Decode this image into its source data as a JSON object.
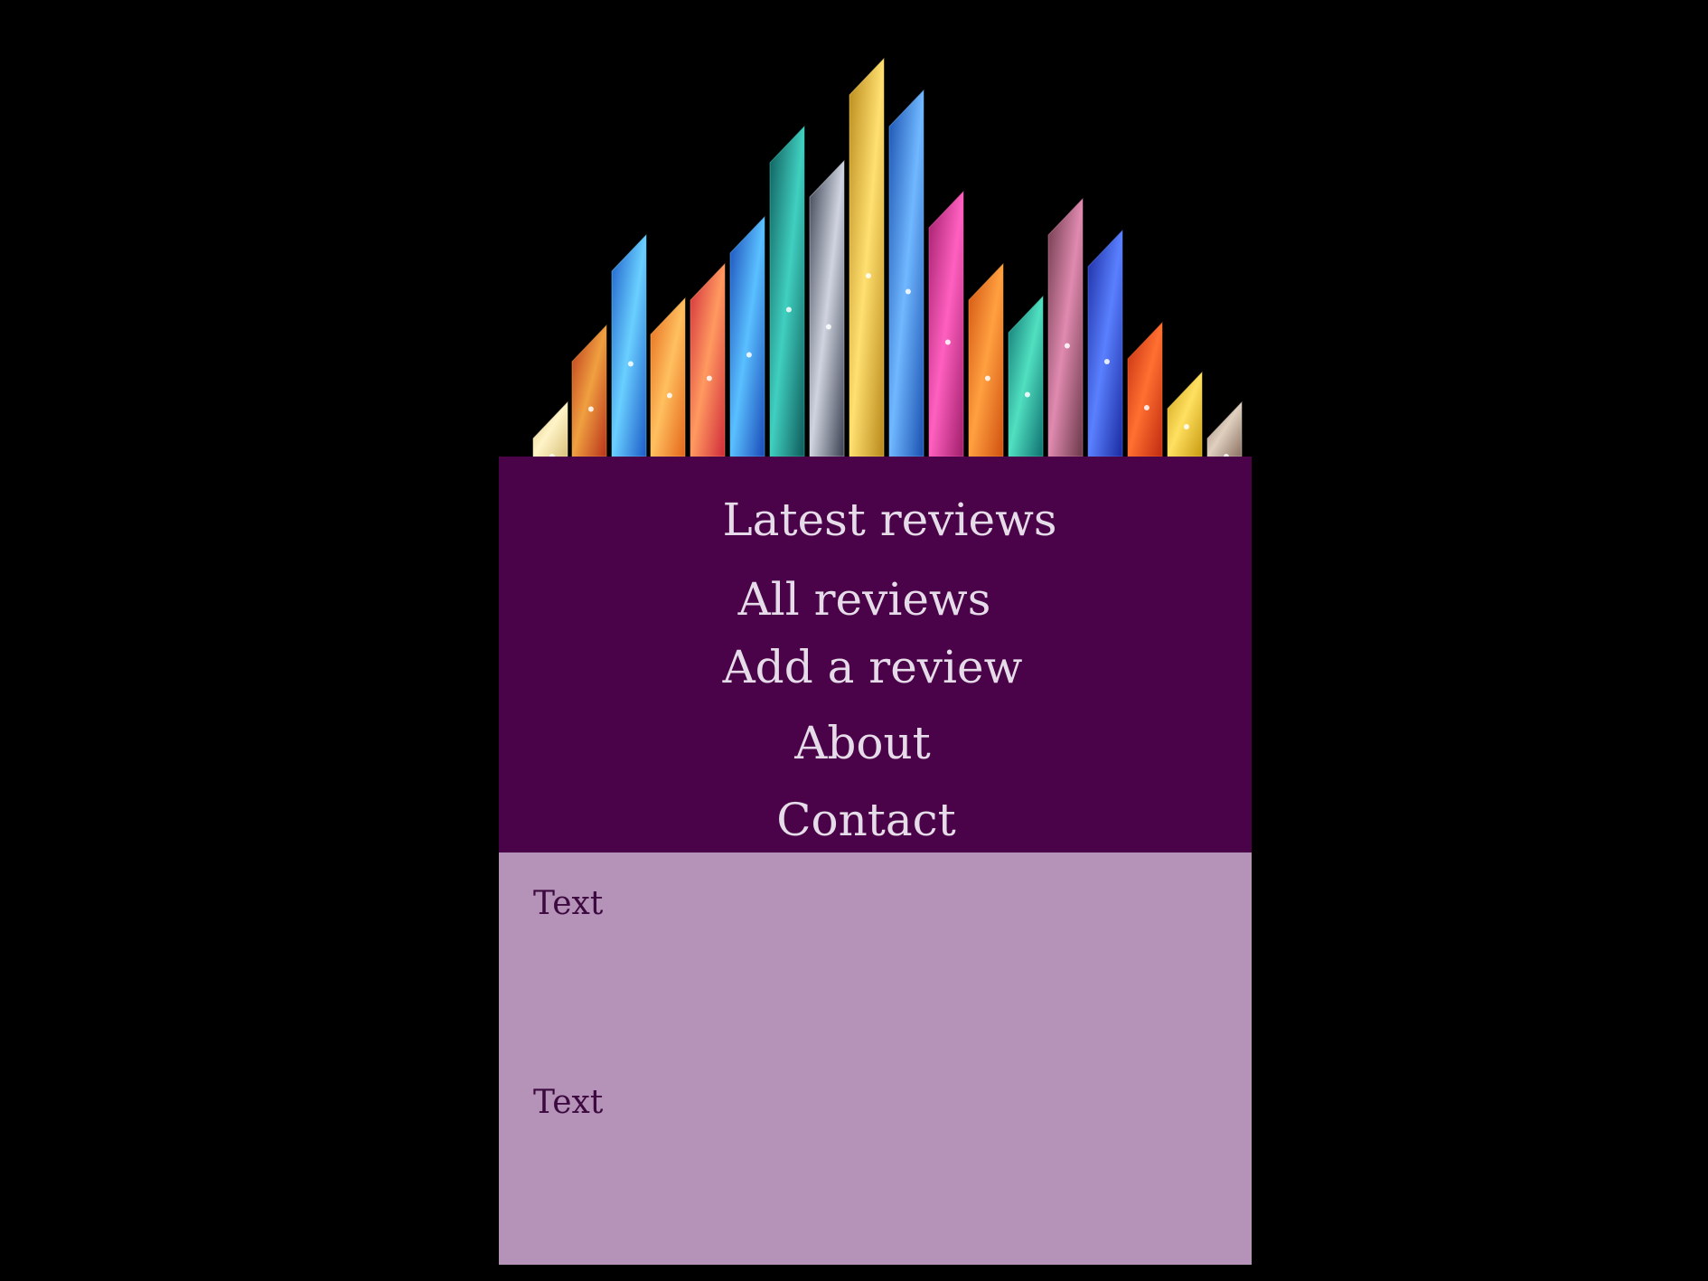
{
  "banner": {
    "image": "cosmic-crystal-spires",
    "crystals": [
      {
        "base": "#d8c07a",
        "glow": "#fff4c8"
      },
      {
        "base": "#b8321a",
        "glow": "#f0a040"
      },
      {
        "base": "#1c5bc8",
        "glow": "#6ad0ff"
      },
      {
        "base": "#e4661a",
        "glow": "#ffc060"
      },
      {
        "base": "#d02a3a",
        "glow": "#ff9a60"
      },
      {
        "base": "#1a4ab8",
        "glow": "#5ac0ff"
      },
      {
        "base": "#0e5a5a",
        "glow": "#40d0c0"
      },
      {
        "base": "#3a4050",
        "glow": "#d0d4e0"
      },
      {
        "base": "#b8881a",
        "glow": "#ffe070"
      },
      {
        "base": "#1a50b0",
        "glow": "#70b8ff"
      },
      {
        "base": "#a01e6a",
        "glow": "#ff60c0"
      },
      {
        "base": "#d05010",
        "glow": "#ffa040"
      },
      {
        "base": "#0e7070",
        "glow": "#50e0c0"
      },
      {
        "base": "#6a3848",
        "glow": "#e08ab0"
      },
      {
        "base": "#1a2aa0",
        "glow": "#5a80ff"
      },
      {
        "base": "#c02a10",
        "glow": "#ff7030"
      },
      {
        "base": "#c89a10",
        "glow": "#ffe060"
      },
      {
        "base": "#8a7060",
        "glow": "#e0d0c0"
      }
    ]
  },
  "nav": {
    "items": [
      {
        "label": "Latest reviews"
      },
      {
        "label": "All reviews"
      },
      {
        "label": "Add a review"
      },
      {
        "label": "About"
      },
      {
        "label": "Contact"
      }
    ]
  },
  "content": {
    "blocks": [
      {
        "text": "Text"
      },
      {
        "text": "Text"
      }
    ]
  },
  "colors": {
    "background": "#000000",
    "nav_background": "#4a0248",
    "nav_text": "#e6dbe8",
    "content_background": "#b593b9",
    "content_text": "#3c0a3e"
  }
}
